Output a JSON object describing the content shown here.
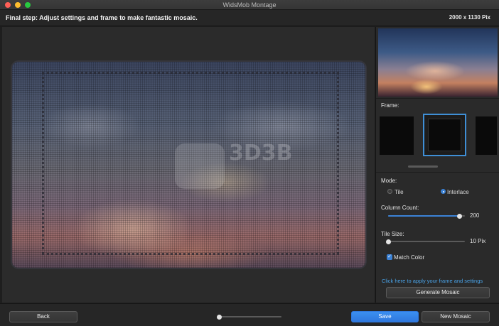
{
  "window": {
    "title": "WidsMob Montage"
  },
  "header": {
    "step_text": "Final step: Adjust settings and frame to make fantastic mosaic.",
    "resolution": "2000 x 1130 Pix"
  },
  "watermark": {
    "text": "3D3B"
  },
  "sidebar": {
    "frame_label": "Frame:",
    "mode_label": "Mode:",
    "mode_options": [
      {
        "label": "Tile",
        "selected": false
      },
      {
        "label": "Interlace",
        "selected": true
      }
    ],
    "column_count": {
      "label": "Column Count:",
      "value": "200",
      "fraction": 0.93
    },
    "tile_size": {
      "label": "Tile Size:",
      "value": "10 Pix",
      "fraction": 0.0
    },
    "match_color": {
      "label": "Match Color",
      "checked": true
    },
    "apply_link": "Click here to apply your frame and settings",
    "generate_button": "Generate Mosaic"
  },
  "footer": {
    "back_button": "Back",
    "zoom_fraction": 0.0,
    "save_button": "Save",
    "new_mosaic_button": "New Mosaic"
  },
  "colors": {
    "accent": "#3b82d6",
    "link": "#4aa3e8",
    "background": "#1e1e1e"
  }
}
